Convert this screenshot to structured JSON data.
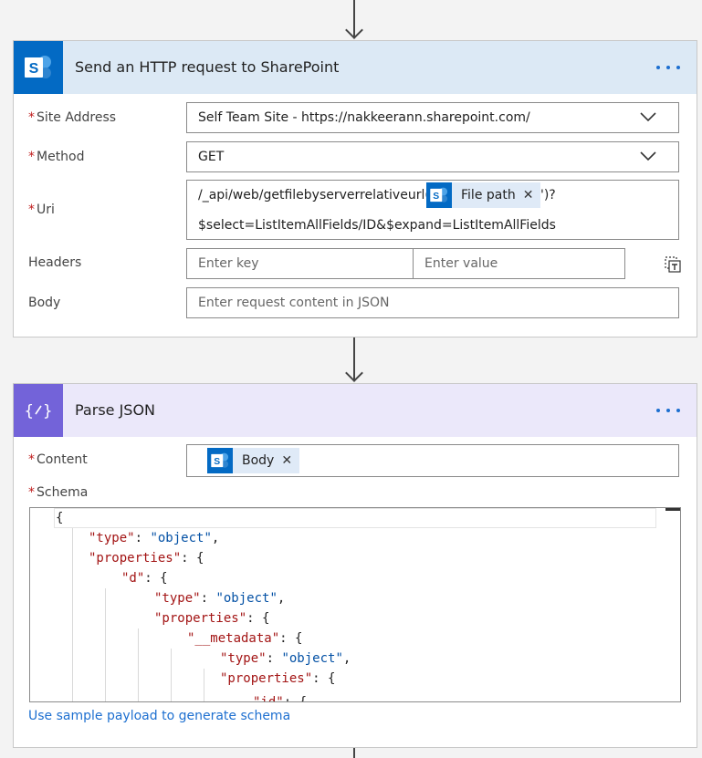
{
  "http_card": {
    "title": "Send an HTTP request to SharePoint",
    "site_label": "Site Address",
    "site_value": "Self Team Site - https://nakkeerann.sharepoint.com/",
    "method_label": "Method",
    "method_value": "GET",
    "uri_label": "Uri",
    "uri_prefix": "/_api/web/getfilebyserverrelativeurl('",
    "uri_token": "File path",
    "uri_suffix": "')?",
    "uri_line2": "$select=ListItemAllFields/ID&$expand=ListItemAllFields",
    "headers_label": "Headers",
    "header_key_placeholder": "Enter key",
    "header_value_placeholder": "Enter value",
    "body_label": "Body",
    "body_placeholder": "Enter request content in JSON"
  },
  "json_card": {
    "title": "Parse JSON",
    "content_label": "Content",
    "content_token": "Body",
    "schema_label": "Schema",
    "schema_lines": [
      "{",
      "\"type\": \"object\",",
      "\"properties\": {",
      "\"d\": {",
      "\"type\": \"object\",",
      "\"properties\": {",
      "\"__metadata\": {",
      "\"type\": \"object\",",
      "\"properties\": {",
      "\"id\": {"
    ],
    "sample_link": "Use sample payload to generate schema"
  },
  "colors": {
    "sharepoint_blue": "#036ac4",
    "parse_json_purple": "#7363d9",
    "link_blue": "#1d6fd0",
    "required_red": "#c02020"
  }
}
